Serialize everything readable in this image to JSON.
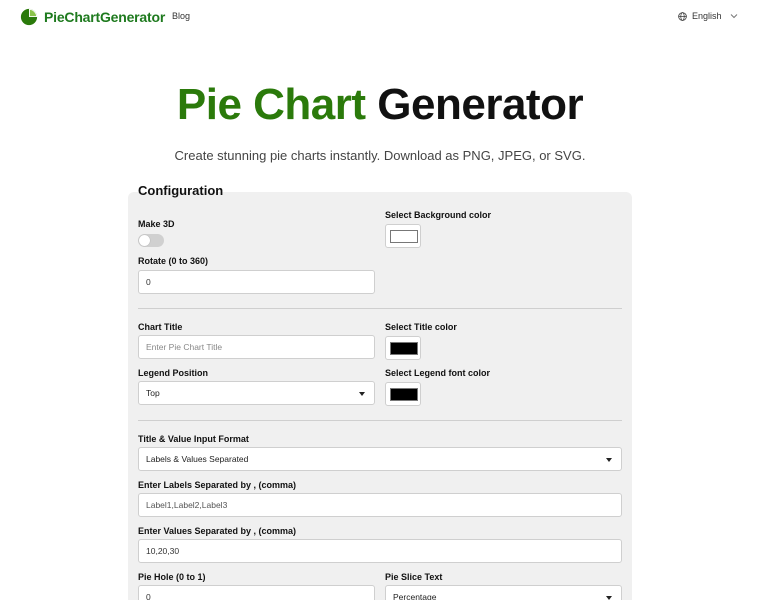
{
  "header": {
    "logo_text": "PieChartGenerator",
    "nav": [
      {
        "label": "Blog"
      }
    ],
    "language": "English"
  },
  "hero": {
    "title_green": "Pie Chart",
    "title_black": "Generator",
    "subtitle": "Create stunning pie charts instantly. Download as PNG, JPEG, or SVG."
  },
  "config": {
    "heading": "Configuration",
    "make_3d": {
      "label": "Make 3D",
      "enabled": false
    },
    "background_color": {
      "label": "Select Background color",
      "value": "#ffffff"
    },
    "rotate": {
      "label": "Rotate (0 to 360)",
      "value": "0"
    },
    "chart_title": {
      "label": "Chart Title",
      "placeholder": "Enter Pie Chart Title"
    },
    "title_color": {
      "label": "Select Title color",
      "value": "#000000"
    },
    "legend_position": {
      "label": "Legend Position",
      "value": "Top"
    },
    "legend_font_color": {
      "label": "Select Legend font color",
      "value": "#000000"
    },
    "input_format": {
      "label": "Title & Value Input Format",
      "value": "Labels & Values Separated"
    },
    "labels": {
      "label": "Enter Labels Separated by , (comma)",
      "value": "Label1,Label2,Label3"
    },
    "values": {
      "label": "Enter Values Separated by , (comma)",
      "value": "10,20,30"
    },
    "pie_hole": {
      "label": "Pie Hole (0 to 1)",
      "value": "0"
    },
    "slice_text": {
      "label": "Pie Slice Text",
      "value": "Percentage"
    }
  },
  "colors": {
    "brand_green": "#2b7a0b",
    "panel_bg": "#f0f0f0"
  }
}
